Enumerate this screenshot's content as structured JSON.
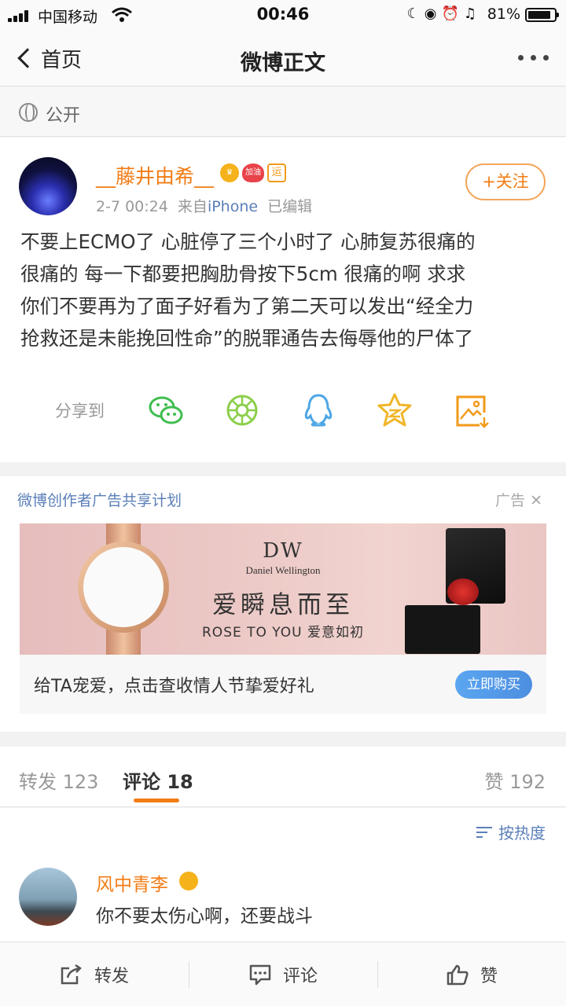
{
  "status_bar": {
    "carrier": "中国移动",
    "time": "00:46",
    "battery": "81%",
    "battery_level": 0.81
  },
  "nav": {
    "back_label": "首页",
    "title": "微博正文"
  },
  "visibility": "公开",
  "post": {
    "username": "__藤井由希__",
    "badge_heart_text": "加油",
    "badge_yun_text": "运",
    "time": "2-7 00:24",
    "source_prefix": "来自",
    "source": "iPhone",
    "edited": "已编辑",
    "follow_label": "+关注",
    "lines": [
      "不要上ECMO了 心脏停了三个小时了 心肺复苏很痛的",
      "很痛的 每一下都要把胸肋骨按下5cm 很痛的啊 求求",
      "你们不要再为了面子好看为了第二天可以发出“经全力",
      "抢救还是未能挽回性命”的脱罪通告去侮辱他的尸体了"
    ],
    "share_label": "分享到",
    "share_icons": [
      "wechat-icon",
      "moments-icon",
      "qq-icon",
      "qzone-icon",
      "save-image-icon"
    ]
  },
  "ad": {
    "header": "微博创作者广告共享计划",
    "tag": "广告",
    "brand_logo": "DW",
    "brand_name": "Daniel Wellington",
    "slogan": "爱瞬息而至",
    "rose_en": "ROSE TO YOU",
    "rose_cn": "爱意如初",
    "caption": "给TA宠爱，点击查收情人节挚爱好礼",
    "buy_label": "立即购买"
  },
  "tabs": {
    "repost_label": "转发",
    "repost_count": "123",
    "comment_label": "评论",
    "comment_count": "18",
    "like_label": "赞",
    "like_count": "192"
  },
  "comments": {
    "sort_label": "按热度",
    "items": [
      {
        "name": "风中青李",
        "text": "你不要太伤心啊，还要战斗"
      }
    ]
  },
  "bottom_bar": {
    "repost": "转发",
    "comment": "评论",
    "like": "赞"
  },
  "colors": {
    "accent_orange": "#f27c14",
    "link_blue": "#5b7fb8"
  }
}
